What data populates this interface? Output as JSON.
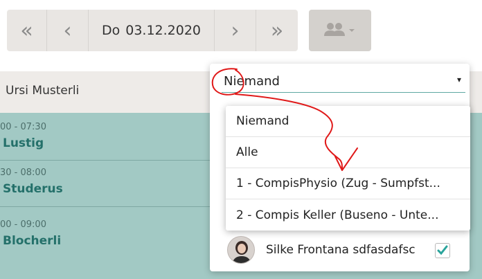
{
  "toolbar": {
    "first_icon": "«",
    "prev_icon": "‹",
    "next_icon": "›",
    "last_icon": "»",
    "date_day": "Do",
    "date_value": "03.12.2020",
    "people_icon": "people-icon",
    "people_caret": "▾"
  },
  "calendar": {
    "header_name": "Ursi Musterli",
    "events": [
      {
        "time": "00 - 07:30",
        "name": "Lustig"
      },
      {
        "time": "30 - 08:00",
        "name": "Studerus"
      },
      {
        "time": "00 - 09:00",
        "name": "Blocherli"
      }
    ]
  },
  "popover": {
    "select_value": "Niemand",
    "select_caret": "▾",
    "options": [
      "Niemand",
      "Alle",
      "1 - CompisPhysio (Zug - Sumpfst...",
      "2 - Compis Keller (Buseno - Unte..."
    ],
    "user": {
      "name": "Silke Frontana sdfasdafsc",
      "checked": true
    }
  },
  "colors": {
    "teal": "#a2c9c4",
    "accent_teal": "#24706a",
    "annotation_red": "#e01919"
  }
}
